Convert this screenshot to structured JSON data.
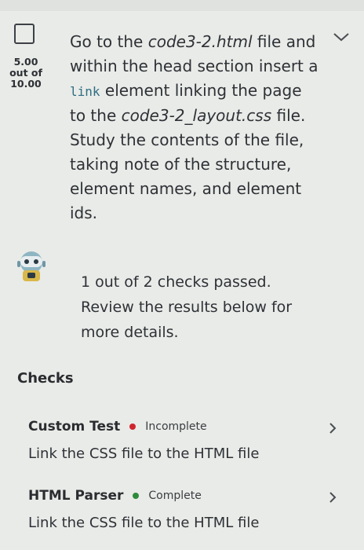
{
  "question": {
    "score_value": "5.00",
    "score_out_of": "out of",
    "score_max": "10.00",
    "instruction_parts": {
      "p1": "Go to the ",
      "file1": "code3-2.html",
      "p2": " file and within the head section insert a ",
      "element": "link",
      "p3": " element linking the page to the ",
      "file2": "code3-2_layout.css",
      "p4": " file. Study the contents of the file, taking note of the structure, element names, and element ids."
    }
  },
  "result": {
    "summary": "1 out of 2 checks passed. Review the results below for more details."
  },
  "checks": {
    "title": "Checks",
    "items": [
      {
        "name": "Custom Test",
        "status": "Incomplete",
        "status_color": "#d0242e",
        "description": "Link the CSS file to the HTML file"
      },
      {
        "name": "HTML Parser",
        "status": "Complete",
        "status_color": "#2e8b3a",
        "description": "Link the CSS file to the HTML file"
      }
    ]
  },
  "icons": [
    "checkbox-icon",
    "chevron-down-icon",
    "robot-icon",
    "chevron-right-icon"
  ]
}
